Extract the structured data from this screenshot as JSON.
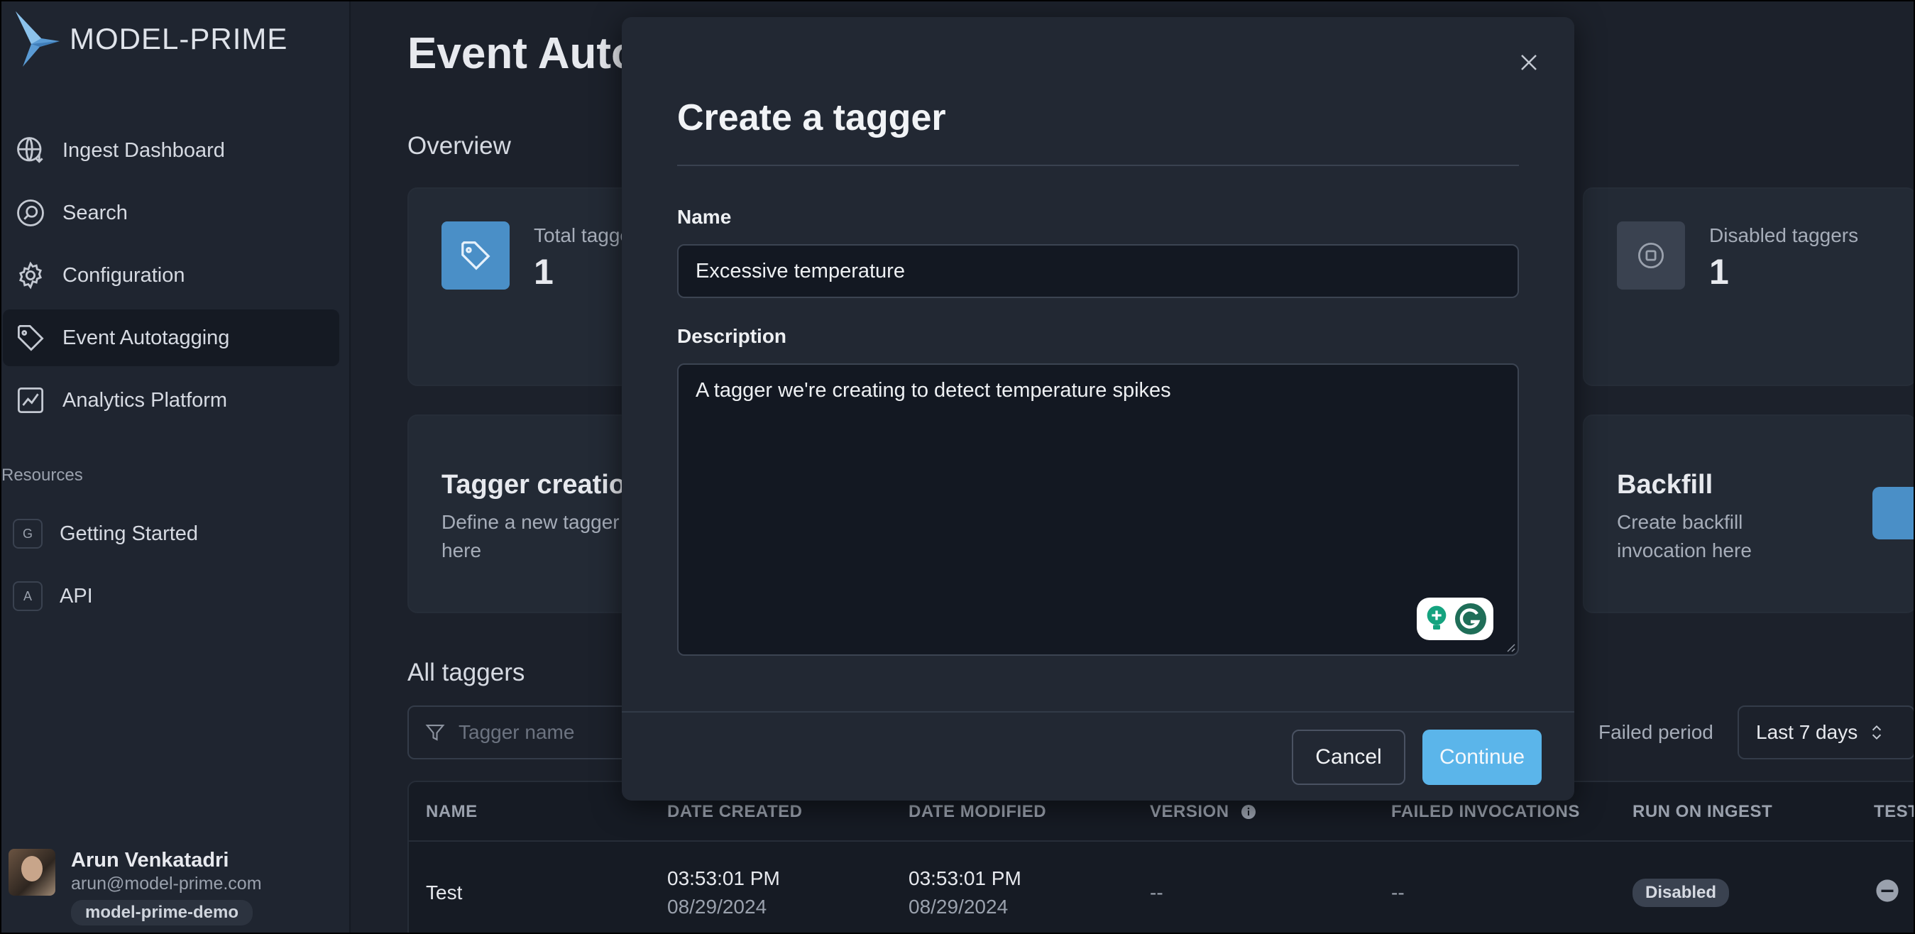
{
  "brand": {
    "name": "MODEL-PRIME"
  },
  "sidebar": {
    "items": [
      {
        "label": "Ingest Dashboard",
        "icon": "globe-download-icon"
      },
      {
        "label": "Search",
        "icon": "search-icon"
      },
      {
        "label": "Configuration",
        "icon": "gear-icon"
      },
      {
        "label": "Event Autotagging",
        "icon": "tag-icon",
        "active": true
      },
      {
        "label": "Analytics Platform",
        "icon": "chart-icon"
      }
    ],
    "resources_title": "Resources",
    "resources": [
      {
        "badge": "G",
        "label": "Getting Started"
      },
      {
        "badge": "A",
        "label": "API"
      }
    ]
  },
  "user": {
    "name": "Arun Venkatadri",
    "email": "arun@model-prime.com",
    "org": "model-prime-demo"
  },
  "page": {
    "title": "Event Autotagging",
    "overview_title": "Overview",
    "stats": {
      "total_label": "Total taggers",
      "total_value": "1",
      "disabled_label": "Disabled taggers",
      "disabled_value": "1"
    },
    "creation": {
      "title": "Tagger creation",
      "desc_line1": "Define a new tagger",
      "desc_line2": "here"
    },
    "backfill": {
      "title": "Backfill",
      "desc_line1": "Create backfill",
      "desc_line2": "invocation here"
    },
    "all_taggers_title": "All taggers",
    "filter_placeholder": "Tagger name",
    "failed_period_label": "Failed period",
    "failed_period_value": "Last 7 days"
  },
  "table": {
    "headers": [
      "NAME",
      "DATE CREATED",
      "DATE MODIFIED",
      "VERSION",
      "FAILED INVOCATIONS",
      "RUN ON INGEST",
      "TEST"
    ],
    "rows": [
      {
        "name": "Test",
        "created_time": "03:53:01 PM",
        "created_date": "08/29/2024",
        "modified_time": "03:53:01 PM",
        "modified_date": "08/29/2024",
        "version": "--",
        "failed": "--",
        "run_on_ingest": "Disabled"
      }
    ]
  },
  "modal": {
    "title": "Create a tagger",
    "name_label": "Name",
    "name_value": "Excessive temperature",
    "description_label": "Description",
    "description_value": "A tagger we're creating to detect temperature spikes",
    "cancel_label": "Cancel",
    "continue_label": "Continue"
  },
  "colors": {
    "accent": "#5bb5ea",
    "tag_icon_bg": "#4a8fc7",
    "background": "#1c212b"
  }
}
